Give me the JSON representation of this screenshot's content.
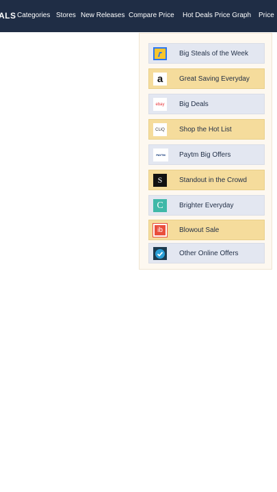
{
  "nav": {
    "brand": "ALS",
    "items": [
      "Categories",
      "Stores",
      "New Releases",
      "Compare Price",
      "Hot Deals Price Graph",
      "Price"
    ]
  },
  "dropdown": {
    "items": [
      {
        "label": "Big Steals of the Week",
        "icon": "flipkart-icon",
        "logo_text": ""
      },
      {
        "label": "Great Saving Everyday",
        "icon": "amazon-icon",
        "logo_text": "a"
      },
      {
        "label": "Big Deals",
        "icon": "ebay-icon",
        "logo_text": "ebay"
      },
      {
        "label": "Shop the Hot List",
        "icon": "tatacliq-icon",
        "logo_text": "CLiQ"
      },
      {
        "label": "Paytm Big Offers",
        "icon": "paytm-icon",
        "logo_text": "PAYTM"
      },
      {
        "label": "Standout in the Crowd",
        "icon": "snapdeal-icon",
        "logo_text": "S"
      },
      {
        "label": "Brighter Everyday",
        "icon": "croma-icon",
        "logo_text": "C"
      },
      {
        "label": "Blowout Sale",
        "icon": "infibeam-icon",
        "logo_text": "ib"
      },
      {
        "label": "Other Online Offers",
        "icon": "check-icon",
        "logo_text": ""
      }
    ]
  },
  "colors": {
    "nav_bg": "#1f2d45",
    "item_blue": "#e3e7f1",
    "item_gold": "#f5dc9c"
  }
}
